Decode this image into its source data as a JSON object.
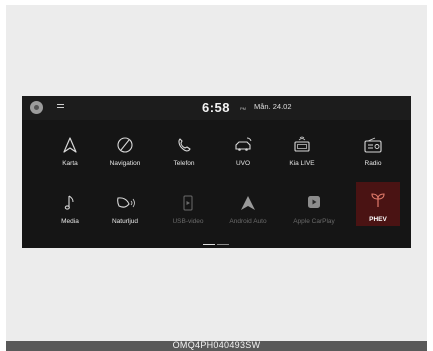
{
  "status": {
    "time": "6:58",
    "ampm": "PM",
    "date": "Mån. 24.02"
  },
  "apps": [
    {
      "label": "Karta",
      "icon": "navigation-arrow-icon",
      "enabled": true
    },
    {
      "label": "Navigation",
      "icon": "compass-icon",
      "enabled": true
    },
    {
      "label": "Telefon",
      "icon": "phone-icon",
      "enabled": true
    },
    {
      "label": "UVO",
      "icon": "connected-car-icon",
      "enabled": true
    },
    {
      "label": "Kia LIVE",
      "icon": "live-service-icon",
      "enabled": true
    },
    {
      "label": "Radio",
      "icon": "radio-icon",
      "enabled": true
    },
    {
      "label": "Media",
      "icon": "music-note-icon",
      "enabled": true
    },
    {
      "label": "Naturljud",
      "icon": "nature-sound-icon",
      "enabled": true
    },
    {
      "label": "USB-video",
      "icon": "usb-video-icon",
      "enabled": false
    },
    {
      "label": "Android Auto",
      "icon": "android-auto-icon",
      "enabled": false
    },
    {
      "label": "Apple CarPlay",
      "icon": "carplay-icon",
      "enabled": false
    },
    {
      "label": "PHEV",
      "icon": "plant-icon",
      "enabled": true,
      "highlighted": true
    }
  ],
  "caption": "OMQ4PH040493SW",
  "colors": {
    "screen_bg": "#151515",
    "phev_tile": "#4a1313",
    "phev_icon": "#e07a6a"
  }
}
